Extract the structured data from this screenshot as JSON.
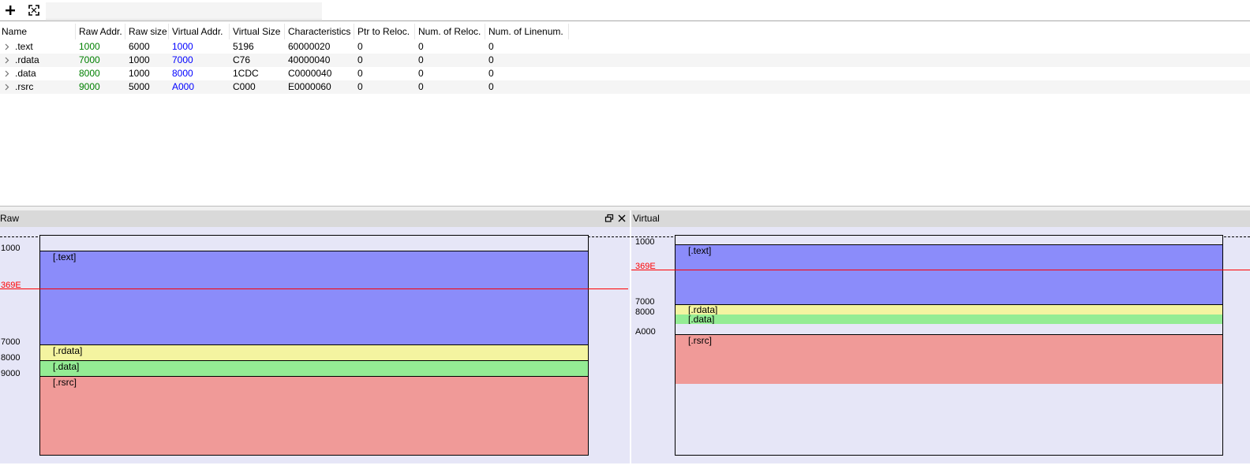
{
  "toolbar": {
    "add_icon": "plus-icon",
    "expand_icon": "expand-icon"
  },
  "table": {
    "columns": [
      "Name",
      "Raw Addr.",
      "Raw size",
      "Virtual Addr.",
      "Virtual Size",
      "Characteristics",
      "Ptr to Reloc.",
      "Num. of Reloc.",
      "Num. of Linenum."
    ],
    "rows": [
      {
        "name": ".text",
        "raw_addr": "1000",
        "raw_size": "6000",
        "virtual_addr": "1000",
        "virtual_size": "5196",
        "characteristics": "60000020",
        "ptr_to_reloc": "0",
        "num_reloc": "0",
        "num_linenum": "0"
      },
      {
        "name": ".rdata",
        "raw_addr": "7000",
        "raw_size": "1000",
        "virtual_addr": "7000",
        "virtual_size": "C76",
        "characteristics": "40000040",
        "ptr_to_reloc": "0",
        "num_reloc": "0",
        "num_linenum": "0"
      },
      {
        "name": ".data",
        "raw_addr": "8000",
        "raw_size": "1000",
        "virtual_addr": "8000",
        "virtual_size": "1CDC",
        "characteristics": "C0000040",
        "ptr_to_reloc": "0",
        "num_reloc": "0",
        "num_linenum": "0"
      },
      {
        "name": ".rsrc",
        "raw_addr": "9000",
        "raw_size": "5000",
        "virtual_addr": "A000",
        "virtual_size": "C000",
        "characteristics": "E0000060",
        "ptr_to_reloc": "0",
        "num_reloc": "0",
        "num_linenum": "0"
      }
    ]
  },
  "raw_pane": {
    "title": "Raw",
    "addresses": [
      "1000",
      "7000",
      "8000",
      "9000"
    ],
    "marker": "369E",
    "sections": [
      "[.text]",
      "[.rdata]",
      "[.data]",
      "[.rsrc]"
    ]
  },
  "virtual_pane": {
    "title": "Virtual",
    "addresses": [
      "1000",
      "7000",
      "8000",
      "A000"
    ],
    "marker": "369E",
    "sections": [
      "[.text]",
      "[.rdata]",
      "[.data]",
      "[.rsrc]"
    ]
  },
  "colors": {
    "raw_addr": "#008000",
    "virtual_addr": "#0000ff",
    "text_section": "#8b8cfa",
    "rdata_section": "#f4f4a0",
    "data_section": "#94ec94",
    "rsrc_section": "#f09a98",
    "marker": "#ff0000",
    "pane_background": "#e6e6f7"
  }
}
